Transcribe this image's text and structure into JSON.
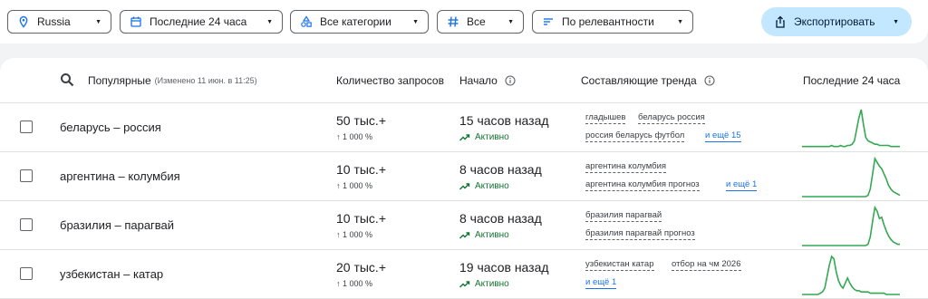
{
  "filters": {
    "region": "Russia",
    "period": "Последние 24 часа",
    "categories": "Все категории",
    "status": "Все",
    "sort": "По релевантности",
    "export": "Экспортировать"
  },
  "table": {
    "headers": {
      "trends": "Популярные",
      "trends_sub": "(Изменено 11 июн. в 11:25)",
      "volume": "Количество запросов",
      "started": "Начало",
      "breakdown": "Составляющие тренда",
      "last24": "Последние 24 часа"
    },
    "rows": [
      {
        "term": "беларусь – россия",
        "volume": "50 тыс.+",
        "increase": "↑ 1 000 %",
        "started": "15 часов назад",
        "status": "Активно",
        "breakdown": [
          "гладышев",
          "беларусь россия",
          "россия беларусь футбол"
        ],
        "more": "и ещё 15",
        "spark": [
          1,
          1,
          1,
          1,
          1,
          1,
          1,
          1,
          1,
          1,
          1,
          1,
          1,
          2,
          1,
          1,
          1,
          2,
          1,
          1,
          2,
          2,
          3,
          6,
          16,
          26,
          33,
          20,
          9,
          6,
          5,
          4,
          3,
          3,
          2,
          2,
          2,
          2,
          2,
          1,
          1,
          1,
          1,
          1
        ]
      },
      {
        "term": "аргентина – колумбия",
        "volume": "10 тыс.+",
        "increase": "↑ 1 000 %",
        "started": "8 часов назад",
        "status": "Активно",
        "breakdown": [
          "аргентина колумбия",
          "аргентина колумбия прогноз"
        ],
        "more": "и ещё 1",
        "spark": [
          0,
          0,
          0,
          0,
          0,
          0,
          0,
          0,
          0,
          0,
          0,
          0,
          0,
          0,
          0,
          0,
          0,
          0,
          0,
          0,
          0,
          0,
          0,
          0,
          0,
          0,
          0,
          0,
          0,
          1,
          6,
          18,
          30,
          27,
          24,
          22,
          18,
          14,
          9,
          6,
          4,
          3,
          2,
          1
        ]
      },
      {
        "term": "бразилия – парагвай",
        "volume": "10 тыс.+",
        "increase": "↑ 1 000 %",
        "started": "8 часов назад",
        "status": "Активно",
        "breakdown": [
          "бразилия парагвай",
          "бразилия парагвай прогноз"
        ],
        "more": "",
        "spark": [
          0,
          0,
          0,
          0,
          0,
          0,
          0,
          0,
          0,
          0,
          0,
          0,
          0,
          0,
          0,
          0,
          0,
          0,
          0,
          0,
          0,
          0,
          0,
          0,
          0,
          0,
          0,
          0,
          0,
          1,
          7,
          20,
          31,
          28,
          22,
          23,
          17,
          12,
          8,
          5,
          3,
          2,
          1,
          1
        ]
      },
      {
        "term": "узбекистан – катар",
        "volume": "20 тыс.+",
        "increase": "↑ 1 000 %",
        "started": "19 часов назад",
        "status": "Активно",
        "breakdown": [
          "узбекистан катар",
          "отбор на чм 2026"
        ],
        "more": "и ещё 1",
        "spark": [
          0,
          0,
          0,
          0,
          0,
          0,
          0,
          0,
          1,
          2,
          5,
          14,
          23,
          30,
          28,
          18,
          11,
          7,
          5,
          9,
          13,
          9,
          6,
          4,
          3,
          3,
          2,
          2,
          2,
          2,
          1,
          1,
          1,
          1,
          1,
          1,
          1,
          0,
          0,
          0,
          0,
          0,
          0,
          0
        ]
      }
    ]
  },
  "colors": {
    "accent": "#c2e7ff",
    "spark": "#34a853",
    "active": "#137333",
    "link": "#1a73e8"
  }
}
